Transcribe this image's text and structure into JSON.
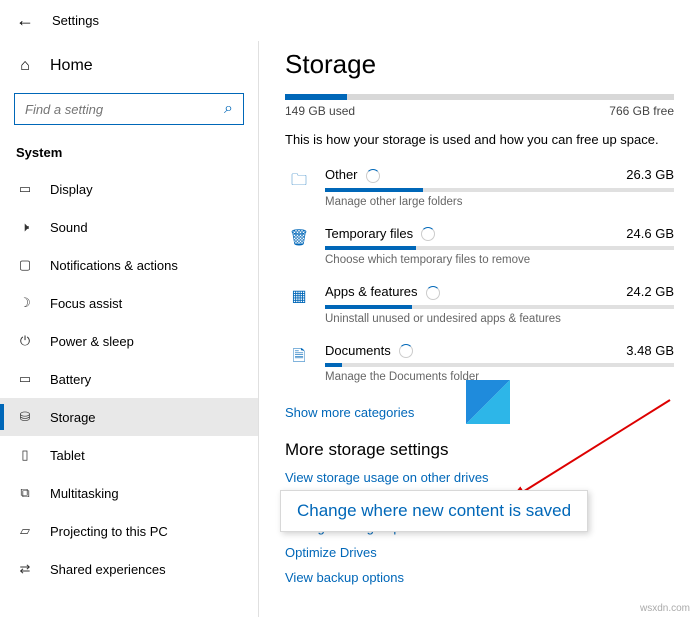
{
  "window": {
    "title": "Settings"
  },
  "sidebar": {
    "home": "Home",
    "search_placeholder": "Find a setting",
    "section": "System",
    "items": [
      {
        "label": "Display"
      },
      {
        "label": "Sound"
      },
      {
        "label": "Notifications & actions"
      },
      {
        "label": "Focus assist"
      },
      {
        "label": "Power & sleep"
      },
      {
        "label": "Battery"
      },
      {
        "label": "Storage"
      },
      {
        "label": "Tablet"
      },
      {
        "label": "Multitasking"
      },
      {
        "label": "Projecting to this PC"
      },
      {
        "label": "Shared experiences"
      }
    ]
  },
  "page": {
    "title": "Storage",
    "used": "149 GB used",
    "free": "766 GB free",
    "used_pct": 16,
    "desc": "This is how your storage is used and how you can free up space.",
    "categories": [
      {
        "name": "Other",
        "size": "26.3 GB",
        "hint": "Manage other large folders",
        "pct": 28
      },
      {
        "name": "Temporary files",
        "size": "24.6 GB",
        "hint": "Choose which temporary files to remove",
        "pct": 26
      },
      {
        "name": "Apps & features",
        "size": "24.2 GB",
        "hint": "Uninstall unused or undesired apps & features",
        "pct": 25
      },
      {
        "name": "Documents",
        "size": "3.48 GB",
        "hint": "Manage the Documents folder",
        "pct": 5
      }
    ],
    "show_more": "Show more categories",
    "more_head": "More storage settings",
    "links": [
      "View storage usage on other drives",
      "Change where new content is saved",
      "Manage Storage Spaces",
      "Optimize Drives",
      "View backup options"
    ]
  },
  "callout": "Change where new content is saved",
  "watermark": "wsxdn.com"
}
